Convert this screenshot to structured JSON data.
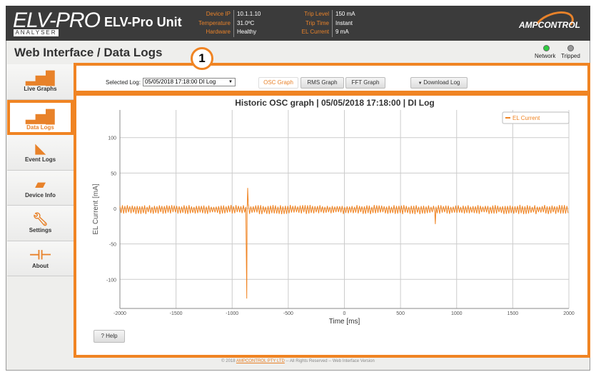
{
  "header": {
    "logo": "ELV-PRO",
    "logo_sub": "ANALYSER",
    "unit_name": "ELV-Pro Unit",
    "status_left": [
      {
        "k": "Device IP",
        "v": "10.1.1.10"
      },
      {
        "k": "Temperature",
        "v": "31.0ºC"
      },
      {
        "k": "Hardware",
        "v": "Healthy"
      }
    ],
    "status_right": [
      {
        "k": "Trip Level",
        "v": "150 mA"
      },
      {
        "k": "Trip Time",
        "v": "Instant"
      },
      {
        "k": "EL Current",
        "v": "9 mA"
      }
    ],
    "brand": "AMPCONTROL"
  },
  "page_title": "Web Interface / Data Logs",
  "indicators": {
    "network": "Network",
    "tripped": "Tripped",
    "network_color": "#2ecc40",
    "tripped_color": "#999999"
  },
  "callout": "1",
  "sidebar": {
    "items": [
      {
        "label": "Live Graphs",
        "icon": "bar-chart"
      },
      {
        "label": "Data Logs",
        "icon": "bar-chart"
      },
      {
        "label": "Event Logs",
        "icon": "area-chart"
      },
      {
        "label": "Device Info",
        "icon": "inbox"
      },
      {
        "label": "Settings",
        "icon": "wrench"
      },
      {
        "label": "About",
        "icon": "signpost"
      }
    ]
  },
  "toolbar": {
    "selected_log_label": "Selected Log:",
    "selected_log": "05/05/2018 17:18:00 DI Log",
    "osc": "OSC Graph",
    "rms": "RMS Graph",
    "fft": "FFT Graph",
    "download": "Download Log"
  },
  "help": "? Help",
  "footer": {
    "prefix": "© 2018",
    "link": "AMPCONTROL PTY LTD",
    "suffix": "-- All Rights Reserved -- Web Interface Version"
  },
  "chart_data": {
    "type": "line",
    "title": "Historic OSC graph | 05/05/2018 17:18:00 | DI Log",
    "xlabel": "Time [ms]",
    "ylabel": "EL Current [mA]",
    "xlim": [
      -2000,
      2000
    ],
    "ylim": [
      -141,
      139
    ],
    "xticks": [
      -2000,
      -1500,
      -1000,
      -500,
      0,
      500,
      1000,
      1500,
      2000
    ],
    "yticks": [
      -100,
      -50,
      0,
      50,
      100
    ],
    "grid": true,
    "legend": "top-right",
    "series": [
      {
        "name": "EL Current",
        "color": "#f08423",
        "baseline": {
          "min": -8,
          "max": 5,
          "period_ms": 22
        },
        "events": [
          {
            "x": -870,
            "y": -127
          },
          {
            "x": -862,
            "y": 29
          },
          {
            "x": -855,
            "y": 5
          },
          {
            "x": 810,
            "y": -22
          }
        ]
      }
    ]
  }
}
